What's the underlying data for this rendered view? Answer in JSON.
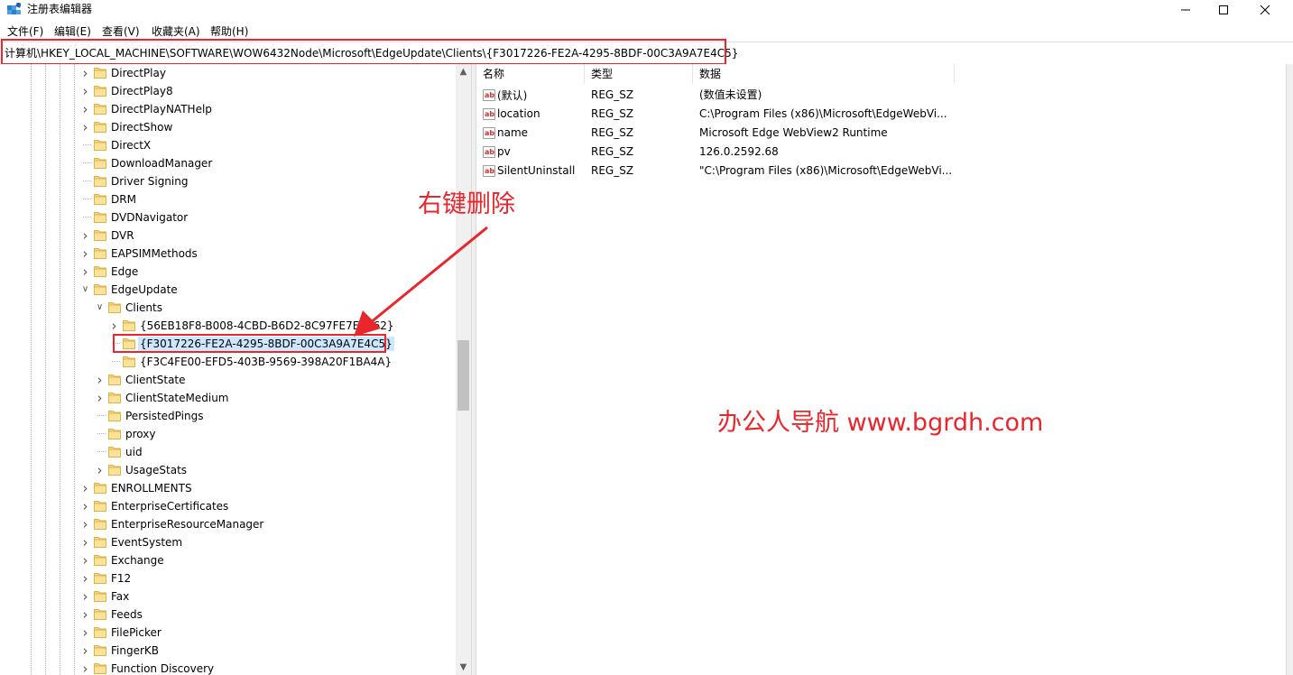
{
  "window": {
    "title": "注册表编辑器"
  },
  "menu": [
    "文件(F)",
    "编辑(E)",
    "查看(V)",
    "收藏夹(A)",
    "帮助(H)"
  ],
  "address": {
    "path": "计算机\\HKEY_LOCAL_MACHINE\\SOFTWARE\\WOW6432Node\\Microsoft\\EdgeUpdate\\Clients\\{F3017226-FE2A-4295-8BDF-00C3A9A7E4C5}"
  },
  "tree": [
    {
      "label": "DirectPlay",
      "level": 0,
      "expander": "collapsed"
    },
    {
      "label": "DirectPlay8",
      "level": 0,
      "expander": "collapsed"
    },
    {
      "label": "DirectPlayNATHelp",
      "level": 0,
      "expander": "collapsed"
    },
    {
      "label": "DirectShow",
      "level": 0,
      "expander": "collapsed"
    },
    {
      "label": "DirectX",
      "level": 0,
      "expander": "none"
    },
    {
      "label": "DownloadManager",
      "level": 0,
      "expander": "none"
    },
    {
      "label": "Driver Signing",
      "level": 0,
      "expander": "none"
    },
    {
      "label": "DRM",
      "level": 0,
      "expander": "none"
    },
    {
      "label": "DVDNavigator",
      "level": 0,
      "expander": "none"
    },
    {
      "label": "DVR",
      "level": 0,
      "expander": "collapsed"
    },
    {
      "label": "EAPSIMMethods",
      "level": 0,
      "expander": "collapsed"
    },
    {
      "label": "Edge",
      "level": 0,
      "expander": "collapsed"
    },
    {
      "label": "EdgeUpdate",
      "level": 0,
      "expander": "expanded"
    },
    {
      "label": "Clients",
      "level": 1,
      "expander": "expanded"
    },
    {
      "label": "{56EB18F8-B008-4CBD-B6D2-8C97FE7E9062}",
      "level": 2,
      "expander": "collapsed"
    },
    {
      "label": "{F3017226-FE2A-4295-8BDF-00C3A9A7E4C5}",
      "level": 2,
      "expander": "none",
      "selected": true
    },
    {
      "label": "{F3C4FE00-EFD5-403B-9569-398A20F1BA4A}",
      "level": 2,
      "expander": "none"
    },
    {
      "label": "ClientState",
      "level": 1,
      "expander": "collapsed"
    },
    {
      "label": "ClientStateMedium",
      "level": 1,
      "expander": "collapsed"
    },
    {
      "label": "PersistedPings",
      "level": 1,
      "expander": "none"
    },
    {
      "label": "proxy",
      "level": 1,
      "expander": "none"
    },
    {
      "label": "uid",
      "level": 1,
      "expander": "none"
    },
    {
      "label": "UsageStats",
      "level": 1,
      "expander": "collapsed"
    },
    {
      "label": "ENROLLMENTS",
      "level": 0,
      "expander": "collapsed"
    },
    {
      "label": "EnterpriseCertificates",
      "level": 0,
      "expander": "collapsed"
    },
    {
      "label": "EnterpriseResourceManager",
      "level": 0,
      "expander": "collapsed"
    },
    {
      "label": "EventSystem",
      "level": 0,
      "expander": "collapsed"
    },
    {
      "label": "Exchange",
      "level": 0,
      "expander": "collapsed"
    },
    {
      "label": "F12",
      "level": 0,
      "expander": "collapsed"
    },
    {
      "label": "Fax",
      "level": 0,
      "expander": "collapsed"
    },
    {
      "label": "Feeds",
      "level": 0,
      "expander": "collapsed"
    },
    {
      "label": "FilePicker",
      "level": 0,
      "expander": "collapsed"
    },
    {
      "label": "FingerKB",
      "level": 0,
      "expander": "collapsed"
    },
    {
      "label": "Function Discovery",
      "level": 0,
      "expander": "collapsed"
    }
  ],
  "values": {
    "columns": {
      "name": "名称",
      "type": "类型",
      "data": "数据"
    },
    "rows": [
      {
        "name": "(默认)",
        "type": "REG_SZ",
        "data": "(数值未设置)"
      },
      {
        "name": "location",
        "type": "REG_SZ",
        "data": "C:\\Program Files (x86)\\Microsoft\\EdgeWebVi..."
      },
      {
        "name": "name",
        "type": "REG_SZ",
        "data": "Microsoft Edge WebView2 Runtime"
      },
      {
        "name": "pv",
        "type": "REG_SZ",
        "data": "126.0.2592.68"
      },
      {
        "name": "SilentUninstall",
        "type": "REG_SZ",
        "data": "\"C:\\Program Files (x86)\\Microsoft\\EdgeWebVi..."
      }
    ]
  },
  "annotations": {
    "delete_hint": "右键删除",
    "watermark": "办公人导航  www.bgrdh.com"
  },
  "colors": {
    "annotation": "#e8262c",
    "selection": "#cce8ff",
    "folder": "#f8d775"
  },
  "icons": {
    "app": "regedit-icon",
    "folder": "folder-icon",
    "value": "string-value-icon"
  }
}
